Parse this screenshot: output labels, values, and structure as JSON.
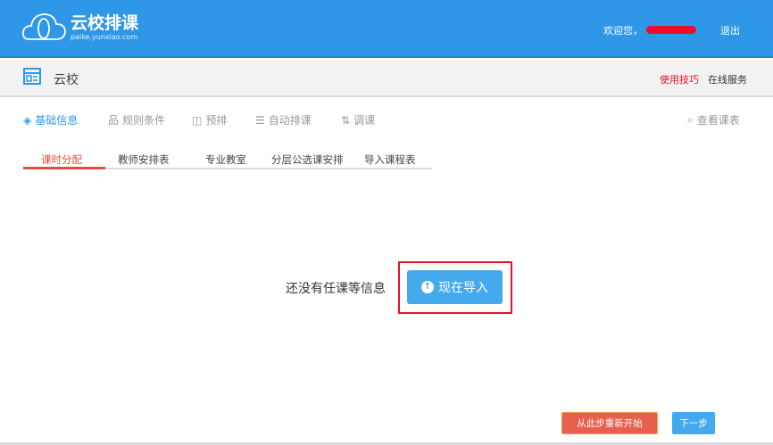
{
  "header": {
    "app_title": "云校排课",
    "app_domain": "paike.yunxiao.com",
    "welcome": "欢迎您，",
    "logout": "退出"
  },
  "subheader": {
    "school": "云校",
    "tips": "使用技巧",
    "service": "在线服务"
  },
  "steps": [
    {
      "label": "基础信息",
      "icon": "layers-icon"
    },
    {
      "label": "规则条件",
      "icon": "hierarchy-icon"
    },
    {
      "label": "预排",
      "icon": "camera-icon"
    },
    {
      "label": "自动排课",
      "icon": "edit-list-icon"
    },
    {
      "label": "调课",
      "icon": "swap-icon"
    }
  ],
  "view_schedule": "查看课表",
  "tabs": [
    "课时分配",
    "教师安排表",
    "专业教室",
    "分层公选课安排",
    "导入课程表"
  ],
  "empty_message": "还没有任课等信息",
  "import_button": "现在导入",
  "restart_button": "从此步重新开始",
  "next_button": "下一步",
  "colors": {
    "brand": "#2f97e8",
    "accent_red": "#e74c3c",
    "button_blue": "#45a9ee"
  }
}
